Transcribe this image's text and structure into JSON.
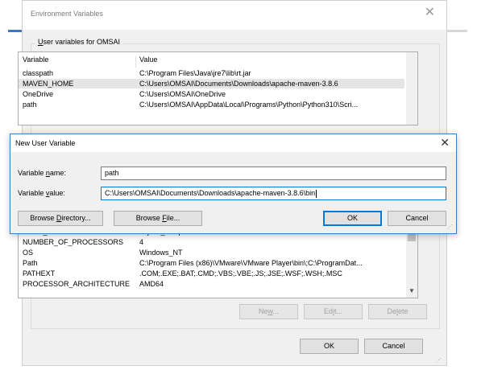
{
  "env_window": {
    "title": "Environment Variables",
    "user_group_label_prefix": "U",
    "user_group_label_rest": "ser variables for OMSAI",
    "user_columns": {
      "variable": "Variable",
      "value": "Value"
    },
    "user_rows": [
      {
        "variable": "classpath",
        "value": "C:\\Program Files\\Java\\jre7\\lib\\rt.jar"
      },
      {
        "variable": "MAVEN_HOME",
        "value": "C:\\Users\\OMSAI\\Documents\\Downloads\\apache-maven-3.8.6"
      },
      {
        "variable": "OneDrive",
        "value": "C:\\Users\\OMSAI\\OneDrive"
      },
      {
        "variable": "path",
        "value": "C:\\Users\\OMSAI\\AppData\\Local\\Programs\\Python\\Python310\\Scri..."
      }
    ],
    "system_rows": [
      {
        "variable": "JUNIT_HOME",
        "value": "d:\\junit_setup"
      },
      {
        "variable": "NUMBER_OF_PROCESSORS",
        "value": "4"
      },
      {
        "variable": "OS",
        "value": "Windows_NT"
      },
      {
        "variable": "Path",
        "value": "C:\\Program Files (x86)\\VMware\\VMware Player\\bin\\;C:\\ProgramDat..."
      },
      {
        "variable": "PATHEXT",
        "value": ".COM;.EXE;.BAT;.CMD;.VBS;.VBE;.JS;.JSE;.WSF;.WSH;.MSC"
      },
      {
        "variable": "PROCESSOR_ARCHITECTURE",
        "value": "AMD64"
      }
    ],
    "system_buttons": {
      "new_a": "Ne",
      "new_u": "w",
      "new_b": "...",
      "edit_a": "Ed",
      "edit_u": "i",
      "edit_b": "t...",
      "delete_a": "De",
      "delete_u": "l",
      "delete_b": "ete"
    },
    "ok_label": "OK",
    "cancel_label": "Cancel"
  },
  "dialog": {
    "title": "New User Variable",
    "name_label_a": "Variable ",
    "name_label_u": "n",
    "name_label_b": "ame:",
    "name_value": "path",
    "value_label_a": "Variable ",
    "value_label_u": "v",
    "value_label_b": "alue:",
    "value_value": "C:\\Users\\OMSAI\\Documents\\Downloads\\apache-maven-3.8.6\\bin",
    "browse_dir_a": "Browse ",
    "browse_dir_u": "D",
    "browse_dir_b": "irectory...",
    "browse_file_a": "Browse ",
    "browse_file_u": "F",
    "browse_file_b": "ile...",
    "ok_label": "OK",
    "cancel_label": "Cancel"
  },
  "colors": {
    "accent": "#0078d7",
    "selection": "#e5e5e5",
    "window_bg": "#f0f0f0"
  }
}
